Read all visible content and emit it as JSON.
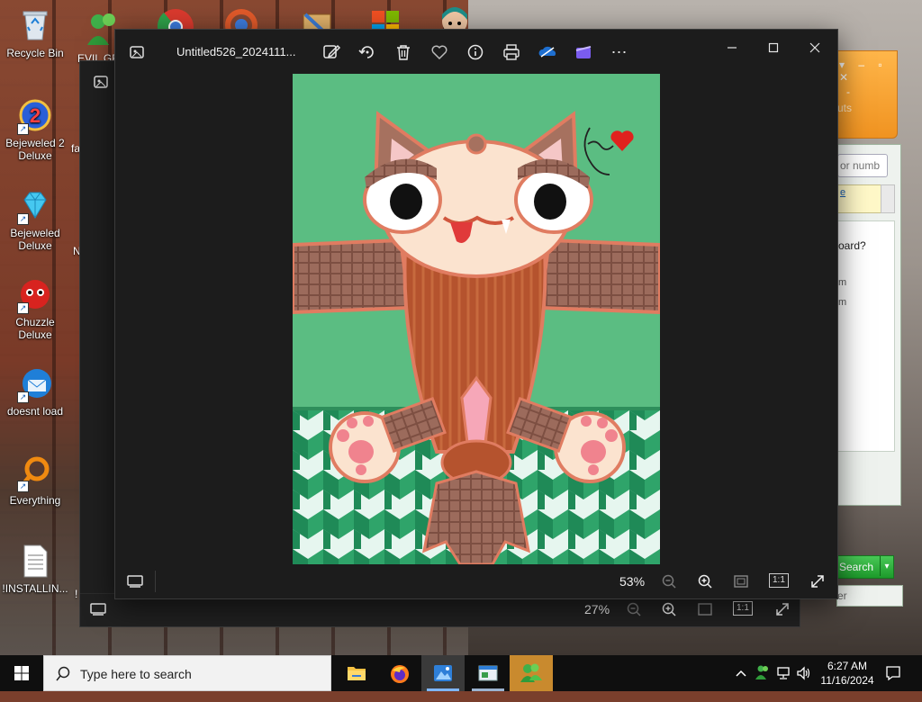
{
  "desktop": {
    "icons": [
      {
        "label": "Recycle Bin",
        "icon": "recycle-bin-icon"
      },
      {
        "label": "Bejeweled 2 Deluxe",
        "icon": "bejeweled2-icon"
      },
      {
        "label": "Bejeweled Deluxe",
        "icon": "bejeweled-icon"
      },
      {
        "label": "Chuzzle Deluxe",
        "icon": "chuzzle-icon"
      },
      {
        "label": "doesnt load",
        "icon": "thunderbird-icon"
      },
      {
        "label": "Everything",
        "icon": "everything-icon"
      },
      {
        "label": "!INSTALLIN...",
        "icon": "document-icon"
      }
    ],
    "partial_labels": [
      "EVIL GR",
      "fa",
      "N",
      "!"
    ]
  },
  "photos_front": {
    "title": "Untitled526_2024111...",
    "toolbar": [
      "edit-icon",
      "rotate-icon",
      "delete-icon",
      "favorite-icon",
      "info-icon",
      "print-icon",
      "onedrive-icon",
      "clipchamp-icon",
      "more-icon"
    ],
    "window_controls": [
      "minimize",
      "maximize",
      "close"
    ],
    "zoom": "53%",
    "zoom_controls": [
      "zoom-out-icon",
      "zoom-in-icon",
      "fit-icon",
      "actual-size-icon",
      "fullscreen-icon"
    ]
  },
  "photos_back": {
    "zoom": "27%"
  },
  "side_app": {
    "line1": "-",
    "line2": "uts",
    "placeholder": "or numb",
    "text1": "oard?",
    "text2": "m",
    "text3": "m",
    "text4": "e",
    "search_label": "Search",
    "footer": "er"
  },
  "taskbar": {
    "search_placeholder": "Type here to search",
    "apps": [
      "file-explorer-icon",
      "firefox-icon",
      "photos-icon",
      "window-icon",
      "messenger-icon"
    ],
    "time": "6:27 AM",
    "date": "11/16/2024"
  },
  "colors": {
    "artwork_bg": "#5bbd82",
    "taskbar": "#0f0f0f",
    "accent": "#7fb6ff"
  }
}
